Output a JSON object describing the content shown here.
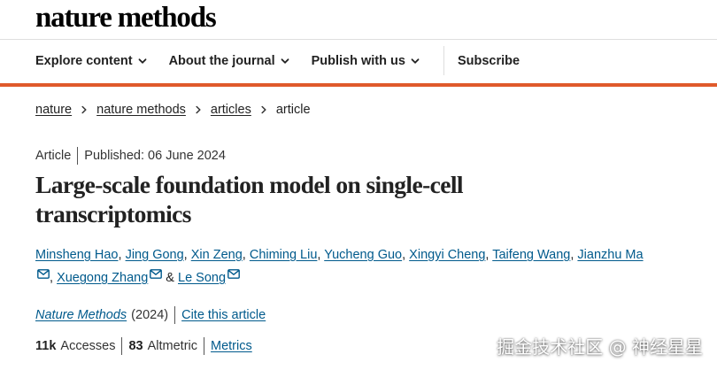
{
  "header": {
    "logo": "nature methods"
  },
  "nav": {
    "items": [
      {
        "label": "Explore content",
        "has_dropdown": true
      },
      {
        "label": "About the journal",
        "has_dropdown": true
      },
      {
        "label": "Publish with us",
        "has_dropdown": true
      }
    ],
    "subscribe_label": "Subscribe"
  },
  "colors": {
    "accent": "#e05a2b",
    "link": "#005a8c"
  },
  "breadcrumb": [
    {
      "label": "nature",
      "link": true
    },
    {
      "label": "nature methods",
      "link": true
    },
    {
      "label": "articles",
      "link": true
    },
    {
      "label": "article",
      "link": false
    }
  ],
  "article": {
    "type": "Article",
    "published": "Published: 06 June 2024",
    "title": "Large-scale foundation model on single-cell transcriptomics",
    "authors": [
      {
        "name": "Minsheng Hao",
        "sep": ", ",
        "mail": false
      },
      {
        "name": "Jing Gong",
        "sep": ", ",
        "mail": false
      },
      {
        "name": "Xin Zeng",
        "sep": ", ",
        "mail": false
      },
      {
        "name": "Chiming Liu",
        "sep": ", ",
        "mail": false
      },
      {
        "name": "Yucheng Guo",
        "sep": ", ",
        "mail": false
      },
      {
        "name": "Xingyi Cheng",
        "sep": ", ",
        "mail": false
      },
      {
        "name": "Taifeng Wang",
        "sep": ", ",
        "mail": false
      },
      {
        "name": "Jianzhu Ma",
        "sep": ", ",
        "mail": true
      },
      {
        "name": "Xuegong Zhang",
        "sep": " & ",
        "mail": true
      },
      {
        "name": "Le Song",
        "sep": "",
        "mail": true
      }
    ],
    "journal": "Nature Methods",
    "year": "(2024)",
    "cite_label": "Cite this article",
    "accesses_count": "11k",
    "accesses_label": "Accesses",
    "altmetric_count": "83",
    "altmetric_label": "Altmetric",
    "metrics_label": "Metrics"
  },
  "watermark": "掘金技术社区 @ 神经星星"
}
